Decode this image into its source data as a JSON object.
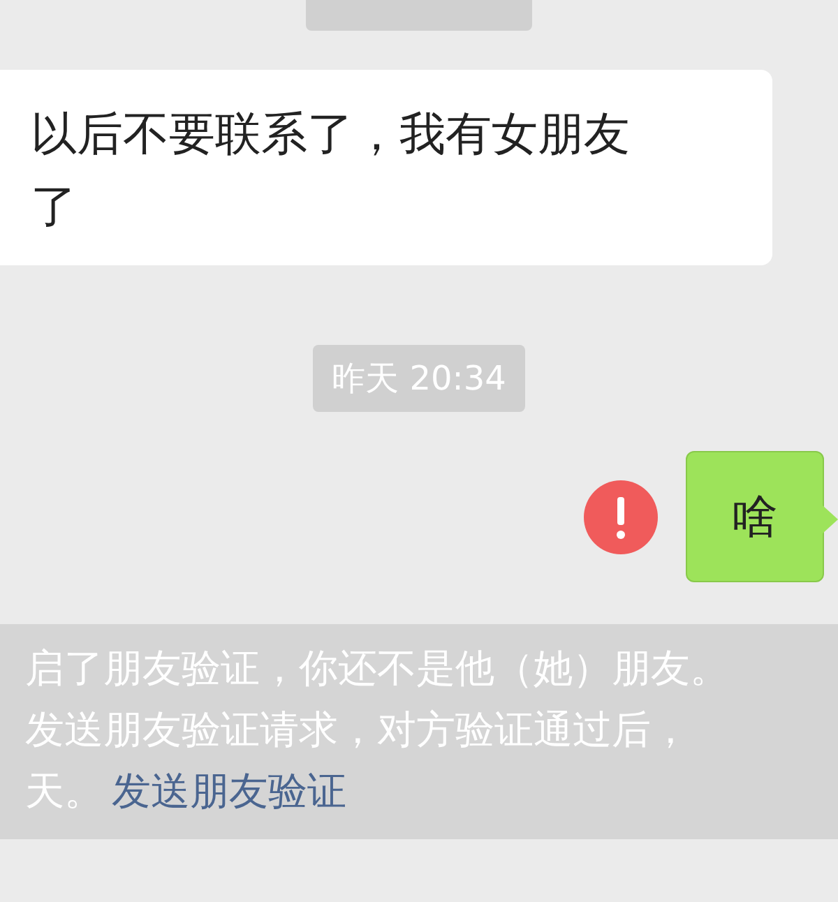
{
  "messages": [
    {
      "kind": "timestamp_cut"
    },
    {
      "kind": "incoming",
      "text": "以后不要联系了，我有女朋友了"
    },
    {
      "kind": "timestamp",
      "text": "昨天 20:34"
    },
    {
      "kind": "outgoing",
      "text": "啥",
      "failed": true
    },
    {
      "kind": "system",
      "lines": [
        "启了朋友验证，你还不是他（她）朋友。",
        "发送朋友验证请求，对方验证通过后，",
        "天。"
      ],
      "link": "发送朋友验证"
    }
  ]
}
